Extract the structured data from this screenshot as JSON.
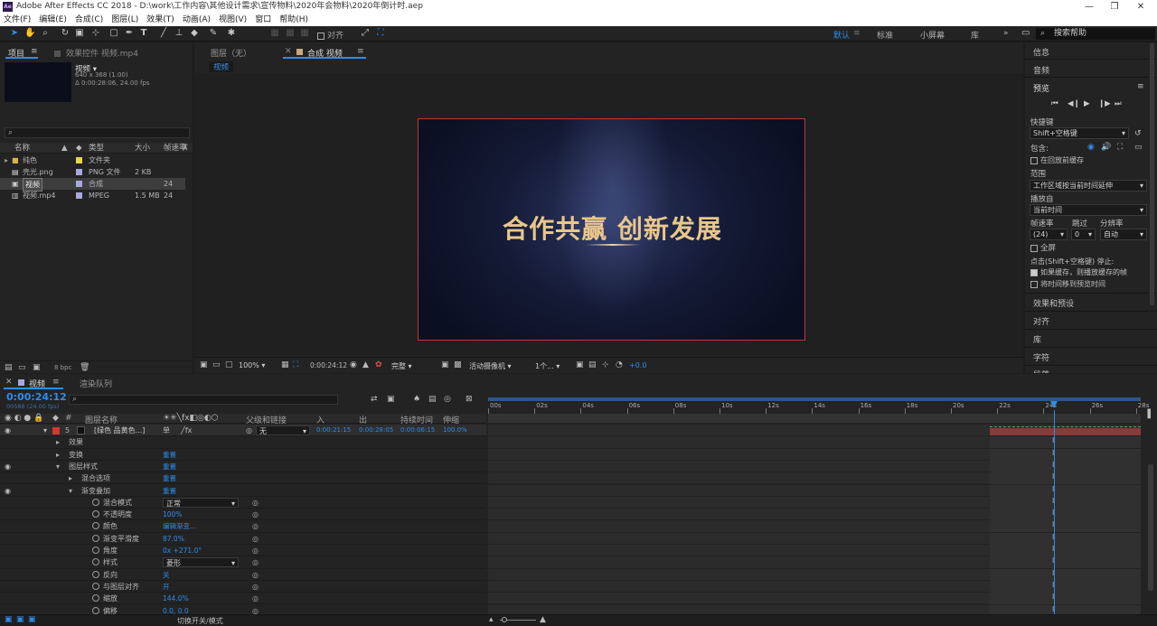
{
  "window": {
    "title": "Adobe After Effects CC 2018 - D:\\work\\工作内容\\其他设计需求\\宣传物料\\2020年会物料\\2020年倒计时.aep",
    "logo": "Ae"
  },
  "menu": [
    "文件(F)",
    "编辑(E)",
    "合成(C)",
    "图层(L)",
    "效果(T)",
    "动画(A)",
    "视图(V)",
    "窗口",
    "帮助(H)"
  ],
  "toolbar": {
    "align_label": "对齐",
    "workspaces": [
      "默认",
      "标准",
      "小屏幕",
      "库"
    ],
    "search_help": "搜索帮助"
  },
  "project": {
    "tab": "项目",
    "effects_tab": "效果控件 视频.mp4",
    "item_name": "视频",
    "item_size": "640 x 368 (1.00)",
    "item_duration": "Δ 0:00:28:06, 24.00 fps",
    "columns": [
      "名称",
      "类型",
      "大小",
      "帧速率"
    ],
    "items": [
      {
        "name": "纯色",
        "type": "文件夹",
        "size": "",
        "fps": "",
        "color": "#e8d54a"
      },
      {
        "name": "壳光.png",
        "type": "PNG 文件",
        "size": "2 KB",
        "fps": "",
        "color": "#a8a8e0"
      },
      {
        "name": "视频",
        "type": "合成",
        "size": "",
        "fps": "24",
        "color": "#a8a8e0"
      },
      {
        "name": "视频.mp4",
        "type": "MPEG",
        "size": "1.5 MB",
        "fps": "24",
        "color": "#a8a8e0"
      }
    ],
    "bpc": "8 bpc"
  },
  "viewer": {
    "layer_tab": "图层（无）",
    "comp_tab": "合成 视频",
    "comp_label": "视频",
    "headline": "合作共赢 创新发展",
    "zoom": "100%",
    "timecode": "0:00:24:12",
    "quality": "完整",
    "camera": "活动摄像机",
    "views": "1个...",
    "exposure": "+0.0"
  },
  "timeline": {
    "tab": "视频",
    "render_tab": "渲染队列",
    "time": "0:00:24:12",
    "frame_info": "00588 (24.00 fps)",
    "headers": [
      "#",
      "图层名称",
      "父级和链接",
      "入",
      "出",
      "持续时间",
      "伸缩"
    ],
    "ruler": [
      "00s",
      "02s",
      "04s",
      "06s",
      "08s",
      "10s",
      "12s",
      "14s",
      "16s",
      "18s",
      "20s",
      "22s",
      "24s",
      "26s",
      "28s"
    ],
    "layer": {
      "num": "5",
      "name": "[绿色 品黄色...]",
      "parent": "无",
      "in": "0:00:21:15",
      "out": "0:00:28:05",
      "duration": "0:00:06:15",
      "stretch": "100.0%"
    },
    "props": [
      {
        "label": "效果",
        "value": "",
        "indent": 1
      },
      {
        "label": "变换",
        "value": "重置",
        "indent": 1
      },
      {
        "label": "图层样式",
        "value": "重置",
        "indent": 1
      },
      {
        "label": "混合选项",
        "value": "重置",
        "indent": 2
      },
      {
        "label": "渐变叠加",
        "value": "重置",
        "indent": 2
      },
      {
        "label": "混合模式",
        "value": "正常",
        "indent": 3
      },
      {
        "label": "不透明度",
        "value": "100%",
        "indent": 3
      },
      {
        "label": "颜色",
        "value": "编辑渐变...",
        "indent": 3
      },
      {
        "label": "渐变平滑度",
        "value": "87.0%",
        "indent": 3
      },
      {
        "label": "角度",
        "value": "0x +271.0°",
        "indent": 3
      },
      {
        "label": "样式",
        "value": "菱形",
        "indent": 3
      },
      {
        "label": "反向",
        "value": "关",
        "indent": 3
      },
      {
        "label": "与图层对齐",
        "value": "开",
        "indent": 3
      },
      {
        "label": "缩放",
        "value": "144.0%",
        "indent": 3
      },
      {
        "label": "偏移",
        "value": "0.0, 0.0",
        "indent": 3
      }
    ],
    "toggle_label": "切换开关/模式"
  },
  "right": {
    "info": "信息",
    "audio": "音频",
    "preview": "预览",
    "shortcut_label": "快捷键",
    "shortcut_value": "Shift+空格键",
    "include_label": "包含:",
    "cache_before": "在回放前缓存",
    "range_label": "范围",
    "range_value": "工作区域按当前时间延伸",
    "play_from_label": "播放自",
    "play_from_value": "当前时间",
    "fps_label": "帧速率",
    "skip_label": "跳过",
    "res_label": "分辨率",
    "fps_value": "(24)",
    "skip_value": "0",
    "res_value": "自动",
    "fullscreen": "全屏",
    "stop_label": "点击(Shift+空格键) 停止:",
    "opt1": "如果缓存，则播放缓存的帧",
    "opt2": "将时间移到预览时间",
    "effects": "效果和预设",
    "align": "对齐",
    "library": "库",
    "character": "字符",
    "paragraph": "段落"
  }
}
